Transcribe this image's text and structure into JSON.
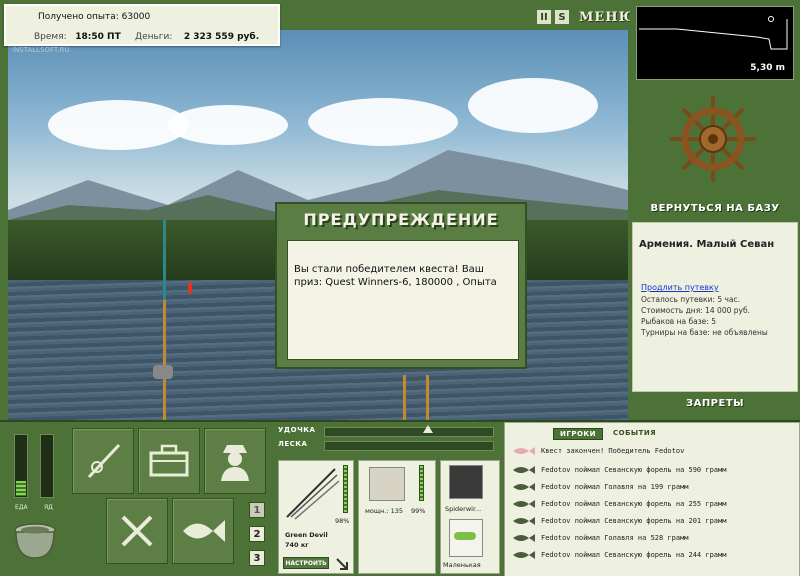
{
  "info": {
    "experience_label": "Получено опыта:",
    "experience_value": "63000",
    "time_label": "Время:",
    "time_value": "18:50 ПТ",
    "money_label": "Деньги:",
    "money_value": "2 323 559 руб."
  },
  "watermark": "INSTALLSOFT.RU",
  "top_buttons": {
    "pause": "II",
    "sound": "S",
    "menu": "МЕНЮ"
  },
  "depth": {
    "value": "5,30 m"
  },
  "base": {
    "return_label": "ВЕРНУТЬСЯ НА БАЗУ",
    "location": "Армения. Малый Севан",
    "extend_link": "Продлить путевку",
    "lines": [
      "Осталось путевки: 5 час.",
      "Стоимость дня: 14 000 руб.",
      "Рыбаков на базе: 5",
      "Турниры на базе: не объявлены"
    ],
    "bans_label": "ЗАПРЕТЫ"
  },
  "dialog": {
    "title": "ПРЕДУПРЕЖДЕНИЕ",
    "message": "Вы стали победителем квеста! Ваш приз: Quest Winners-6, 180000 , Опыта"
  },
  "gauges": {
    "food_label": "ЕДА",
    "poison_label": "ЯД",
    "food_level": 0.25,
    "poison_level": 0.0
  },
  "pages": [
    "1",
    "2",
    "3"
  ],
  "tackle": {
    "rod_label": "УДОЧКА",
    "line_label": "ЛЕСКА",
    "rod_name": "Green Devil",
    "rod_weight": "740 кг",
    "rod_percent": "98%",
    "reel_power": "мощн.: 135",
    "reel_percent": "99%",
    "line_name": "Spiderwir...",
    "bait_name": "Маленькая",
    "setup_button": "НАСТРОИТЬ"
  },
  "log": {
    "tabs": [
      "ИГРОКИ",
      "СОБЫТИЯ"
    ],
    "entries": [
      "Квест закончен! Победитель Fedotov",
      "Fedotov поймал Севанскую форель на 590 грамм",
      "Fedotov поймал Голавля на 199 грамм",
      "Fedotov поймал Севанскую форель на 255 грамм",
      "Fedotov поймал Севанскую форель на 201 грамм",
      "Fedotov поймал Голавля на 528 грамм",
      "Fedotov поймал Севанскую форель на 244 грамм"
    ]
  },
  "colors": {
    "panel": "#4d7238",
    "card": "#eef0e0",
    "accent_dark": "#35501f"
  }
}
